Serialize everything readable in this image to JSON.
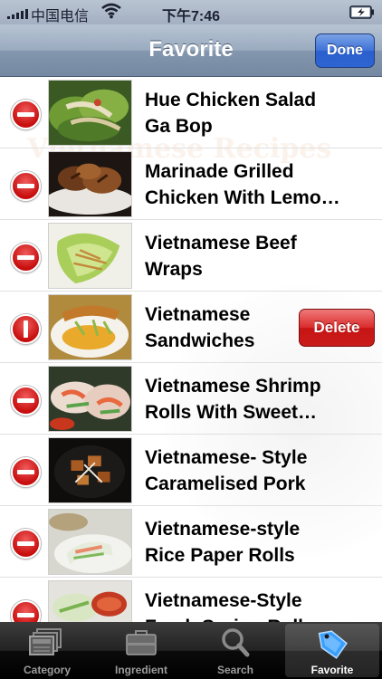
{
  "status_bar": {
    "carrier": "中国电信",
    "time": "下午7:46"
  },
  "nav": {
    "title": "Favorite",
    "done_label": "Done"
  },
  "background": {
    "watermark": "Vietnamese Recipes"
  },
  "list": {
    "items": [
      {
        "title": "Hue Chicken Salad\nGa Bop",
        "thumb": "salad-lettuce-leaves"
      },
      {
        "title": "Marinade Grilled\nChicken With Lemo…",
        "thumb": "grilled-chicken"
      },
      {
        "title": "Vietnamese Beef\nWraps",
        "thumb": "lettuce-wrap"
      },
      {
        "title": "Vietnamese\nSandwiches",
        "thumb": "sandwich-plate",
        "delete_label": "Delete"
      },
      {
        "title": "Vietnamese Shrimp\nRolls With Sweet…",
        "thumb": "shrimp-rolls"
      },
      {
        "title": "Vietnamese- Style\nCaramelised Pork",
        "thumb": "caramelised-pork"
      },
      {
        "title": "Vietnamese-style\nRice Paper Rolls",
        "thumb": "rice-paper-rolls"
      },
      {
        "title": "Vietnamese-Style\nFresh Spring Rolls",
        "thumb": "spring-rolls"
      }
    ]
  },
  "tab_bar": {
    "tabs": [
      {
        "label": "Category",
        "icon": "category-icon"
      },
      {
        "label": "Ingredient",
        "icon": "ingredient-icon"
      },
      {
        "label": "Search",
        "icon": "search-icon"
      },
      {
        "label": "Favorite",
        "icon": "favorite-tag-icon",
        "active": true
      }
    ]
  }
}
